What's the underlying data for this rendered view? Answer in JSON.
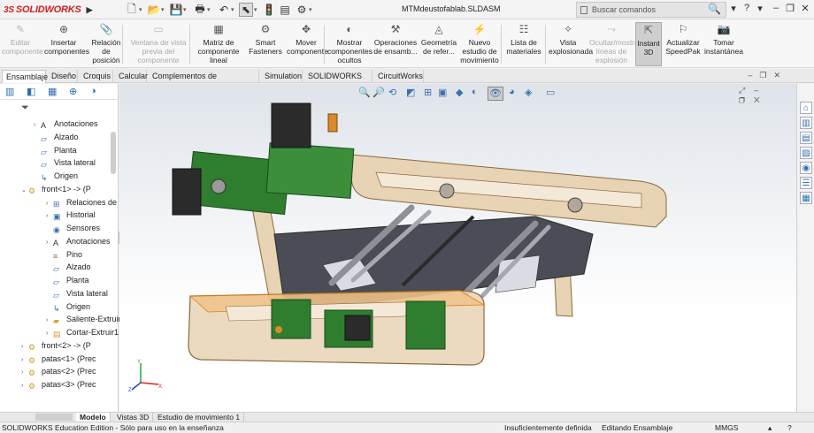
{
  "titlebar": {
    "logo_ds": "3S",
    "logo_text": "SOLIDWORKS",
    "doc_title": "MTMdeustofablab.SLDASM",
    "search_placeholder": "Buscar comandos"
  },
  "commands": [
    {
      "id": "editar-componente",
      "label": "Editar\ncomponente",
      "icon": "edit-component-icon",
      "disabled": true
    },
    {
      "id": "insertar-componentes",
      "label": "Insertar\ncomponentes",
      "icon": "insert-component-icon",
      "disabled": false
    },
    {
      "id": "relacion-de-posicion",
      "label": "Relación\nde\nposición",
      "icon": "mate-icon",
      "disabled": false
    },
    {
      "id": "vista-previa",
      "label": "Ventana de vista\nprevia del\ncomponente",
      "icon": "preview-window-icon",
      "disabled": true
    },
    {
      "id": "matriz-componente-lineal",
      "label": "Matriz de\ncomponente lineal",
      "icon": "linear-pattern-icon",
      "disabled": false
    },
    {
      "id": "smart-fasteners",
      "label": "Smart\nFasteners",
      "icon": "smart-fastener-icon",
      "disabled": false
    },
    {
      "id": "mover-componente",
      "label": "Mover\ncomponente",
      "icon": "move-component-icon",
      "disabled": false
    },
    {
      "id": "mostrar-componentes-ocultos",
      "label": "Mostrar\ncomponentes\nocultos",
      "icon": "show-hidden-icon",
      "disabled": false
    },
    {
      "id": "operaciones-ensamblaje",
      "label": "Operaciones\nde ensamb...",
      "icon": "assembly-features-icon",
      "disabled": false
    },
    {
      "id": "geometria-referencia",
      "label": "Geometría\nde refer...",
      "icon": "reference-geometry-icon",
      "disabled": false
    },
    {
      "id": "nuevo-estudio-movimiento",
      "label": "Nuevo\nestudio de\nmovimiento",
      "icon": "motion-study-icon",
      "disabled": false
    },
    {
      "id": "lista-materiales",
      "label": "Lista de\nmateriales",
      "icon": "bom-icon",
      "disabled": false
    },
    {
      "id": "vista-explosionada",
      "label": "Vista\nexplosionada",
      "icon": "exploded-view-icon",
      "disabled": false
    },
    {
      "id": "ocultar-mostrar-croquis",
      "label": "Ocultar/mostrar\nlíneas de\nexplosión",
      "icon": "explode-line-icon",
      "disabled": true
    },
    {
      "id": "instant-3d",
      "label": "Instant\n3D",
      "icon": "instant3d-icon",
      "disabled": false,
      "active": true
    },
    {
      "id": "actualizar-speedpak",
      "label": "Actualizar\nSpeedPak",
      "icon": "speedpak-icon",
      "disabled": false
    },
    {
      "id": "tomar-instantanea",
      "label": "Tomar\ninstantánea",
      "icon": "snapshot-icon",
      "disabled": false
    }
  ],
  "tabs": [
    "Ensamblaje",
    "Diseño",
    "Croquis",
    "Calcular",
    "Complementos de SOLIDWORKS",
    "Simulation",
    "SOLIDWORKS MBD",
    "CircuitWorks"
  ],
  "active_tab": "Ensamblaje",
  "tree": [
    {
      "label": "Anotaciones",
      "indent": 1,
      "expand": "›",
      "icon": "annotation-icon"
    },
    {
      "label": "Alzado",
      "indent": 1,
      "expand": "",
      "icon": "plane-icon"
    },
    {
      "label": "Planta",
      "indent": 1,
      "expand": "",
      "icon": "plane-icon"
    },
    {
      "label": "Vista lateral",
      "indent": 1,
      "expand": "",
      "icon": "plane-icon"
    },
    {
      "label": "Origen",
      "indent": 1,
      "expand": "",
      "icon": "origin-icon"
    },
    {
      "label": "front<1> -> (P",
      "indent": 0,
      "expand": "⌄",
      "icon": "part-icon"
    },
    {
      "label": "Relaciones de p",
      "indent": 2,
      "expand": "›",
      "icon": "mate-folder-icon"
    },
    {
      "label": "Historial",
      "indent": 2,
      "expand": "›",
      "icon": "history-icon"
    },
    {
      "label": "Sensores",
      "indent": 2,
      "expand": "",
      "icon": "sensor-icon"
    },
    {
      "label": "Anotaciones",
      "indent": 2,
      "expand": "›",
      "icon": "annotation-icon"
    },
    {
      "label": "Pino",
      "indent": 2,
      "expand": "",
      "icon": "material-icon"
    },
    {
      "label": "Alzado",
      "indent": 2,
      "expand": "",
      "icon": "plane-icon"
    },
    {
      "label": "Planta",
      "indent": 2,
      "expand": "",
      "icon": "plane-icon"
    },
    {
      "label": "Vista lateral",
      "indent": 2,
      "expand": "",
      "icon": "plane-icon"
    },
    {
      "label": "Origen",
      "indent": 2,
      "expand": "",
      "icon": "origin-icon"
    },
    {
      "label": "Saliente-Extruir",
      "indent": 2,
      "expand": "›",
      "icon": "extrude-icon"
    },
    {
      "label": "Cortar-Extruir1",
      "indent": 2,
      "expand": "›",
      "icon": "cut-extrude-icon"
    },
    {
      "label": "front<2> -> (P",
      "indent": 0,
      "expand": "›",
      "icon": "part-icon"
    },
    {
      "label": "patas<1> (Prec",
      "indent": 0,
      "expand": "›",
      "icon": "part-icon"
    },
    {
      "label": "patas<2> (Prec",
      "indent": 0,
      "expand": "›",
      "icon": "part-icon"
    },
    {
      "label": "patas<3> (Prec",
      "indent": 0,
      "expand": "›",
      "icon": "part-icon"
    }
  ],
  "bottom_tabs": [
    "Modelo",
    "Vistas 3D",
    "Estudio de movimiento 1"
  ],
  "active_bottom_tab": "Modelo",
  "status": {
    "edition": "SOLIDWORKS Education Edition - Sólo para uso en la enseñanza",
    "definition": "Insuficientemente definida",
    "mode": "Editando Ensamblaje",
    "units": "MMGS"
  },
  "colors": {
    "brand_red": "#d21f1f",
    "wood": "#e8d3b4",
    "wood_edge": "#8a6a3e",
    "pcb_green": "#2f7d2f",
    "motor_dark": "#2b2b2b",
    "rail_gray": "#8d9096",
    "viewport_top": "#dfe4ea"
  }
}
